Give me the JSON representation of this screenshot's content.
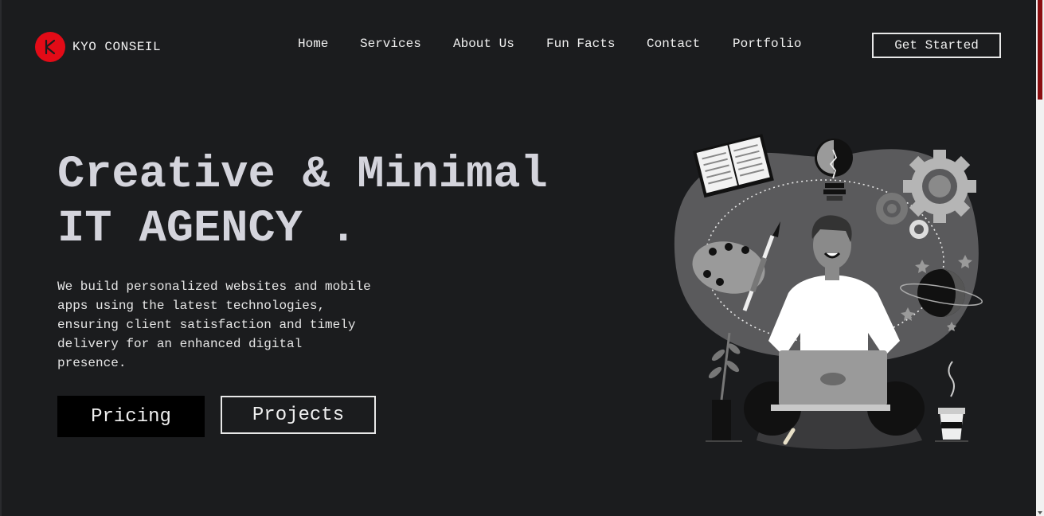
{
  "brand": {
    "logo_letter": "K",
    "name": "KYO CONSEIL",
    "color": "#e30b17"
  },
  "nav": {
    "items": [
      {
        "label": "Home"
      },
      {
        "label": "Services"
      },
      {
        "label": "About Us"
      },
      {
        "label": "Fun Facts"
      },
      {
        "label": "Contact"
      },
      {
        "label": "Portfolio"
      }
    ]
  },
  "header": {
    "cta_label": "Get Started"
  },
  "hero": {
    "title_line1": "Creative & Minimal",
    "title_line2": "IT AGENCY .",
    "description": "We build personalized websites and mobile apps using the latest technologies, ensuring client satisfaction and timely delivery for an enhanced digital presence.",
    "pricing_label": "Pricing",
    "projects_label": "Projects"
  },
  "colors": {
    "background": "#1b1c1e",
    "accent": "#e30b17",
    "text": "#e6e6e6"
  }
}
